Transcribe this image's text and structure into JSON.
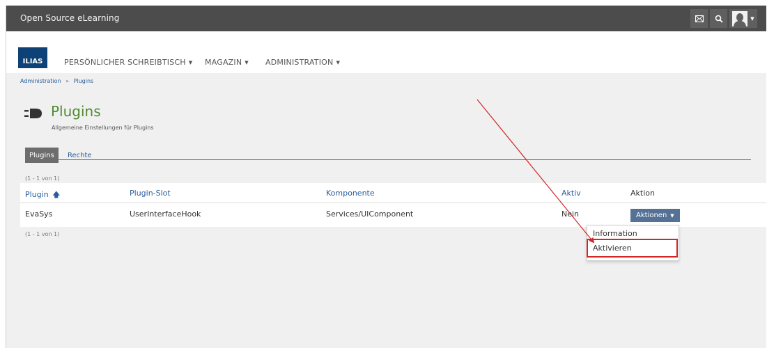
{
  "topbar": {
    "title": "Open Source eLearning",
    "icons": [
      "envelope-icon",
      "search-icon",
      "user-avatar-icon"
    ]
  },
  "logo": {
    "text": "ILIAS"
  },
  "mainnav": [
    {
      "label": "PERSÖNLICHER SCHREIBTISCH"
    },
    {
      "label": "MAGAZIN"
    },
    {
      "label": "ADMINISTRATION"
    }
  ],
  "breadcrumb": {
    "items": [
      "Administration",
      "Plugins"
    ],
    "separator": "»"
  },
  "page": {
    "title": "Plugins",
    "subtitle": "Allgemeine Einstellungen für Plugins",
    "title_color": "#4f8a30"
  },
  "tabs": [
    {
      "label": "Plugins",
      "active": true
    },
    {
      "label": "Rechte",
      "active": false
    }
  ],
  "table": {
    "range_text": "(1 - 1 von 1)",
    "columns": [
      "Plugin",
      "Plugin-Slot",
      "Komponente",
      "Aktiv",
      "Aktion"
    ],
    "sort_indicator": "🡅",
    "rows": [
      {
        "plugin": "EvaSys",
        "slot": "UserInterfaceHook",
        "komponente": "Services/UIComponent",
        "aktiv": "Nein",
        "aktion": "Aktionen"
      }
    ]
  },
  "dropdown": {
    "items": [
      "Information",
      "Aktivieren"
    ],
    "highlighted_item": "Aktivieren"
  },
  "colors": {
    "topbar": "#4c4c4c",
    "link": "#2a5d9a",
    "action_button": "#557196",
    "annotation_red": "#d32626"
  }
}
